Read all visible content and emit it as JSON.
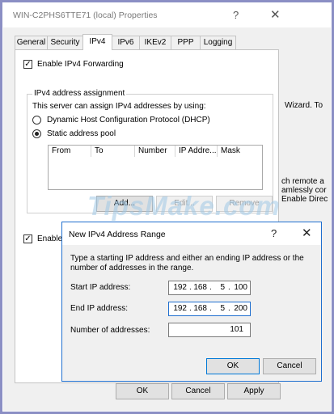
{
  "properties": {
    "title": "WIN-C2PHS6TTE71 (local) Properties",
    "help_glyph": "?",
    "close_glyph": "✕",
    "tabs": [
      "General",
      "Security",
      "IPv4",
      "IPv6",
      "IKEv2",
      "PPP",
      "Logging"
    ],
    "active_tab": "IPv4",
    "enable_forwarding_label": "Enable IPv4 Forwarding",
    "group_title": "IPv4 address assignment",
    "group_desc": "This server can assign IPv4 addresses by using:",
    "radio_dhcp": "Dynamic Host Configuration Protocol (DHCP)",
    "radio_static": "Static address pool",
    "table_headers": [
      "From",
      "To",
      "Number",
      "IP Addre...",
      "Mask"
    ],
    "add_button": "Add...",
    "edit_button": "Edit...",
    "remove_button": "Remove",
    "enable_b_label": "Enable B",
    "ok_button": "OK",
    "cancel_button": "Cancel",
    "apply_button": "Apply"
  },
  "background_text": {
    "wizard": "Wizard. To",
    "remote": "ch remote a",
    "seamless": "amlessly cor",
    "enable_direct": "Enable Direc"
  },
  "watermark": "TipsMake.com",
  "range_dialog": {
    "title": "New IPv4 Address Range",
    "help_glyph": "?",
    "close_glyph": "✕",
    "description": "Type a starting IP address and either an ending IP address or the number of addresses in the range.",
    "start_label": "Start IP address:",
    "start_ip": [
      "192",
      "168",
      "5",
      "100"
    ],
    "end_label": "End IP address:",
    "end_ip": [
      "192",
      "168",
      "5",
      "200"
    ],
    "count_label": "Number of addresses:",
    "count_value": "101",
    "ok_button": "OK",
    "cancel_button": "Cancel"
  }
}
